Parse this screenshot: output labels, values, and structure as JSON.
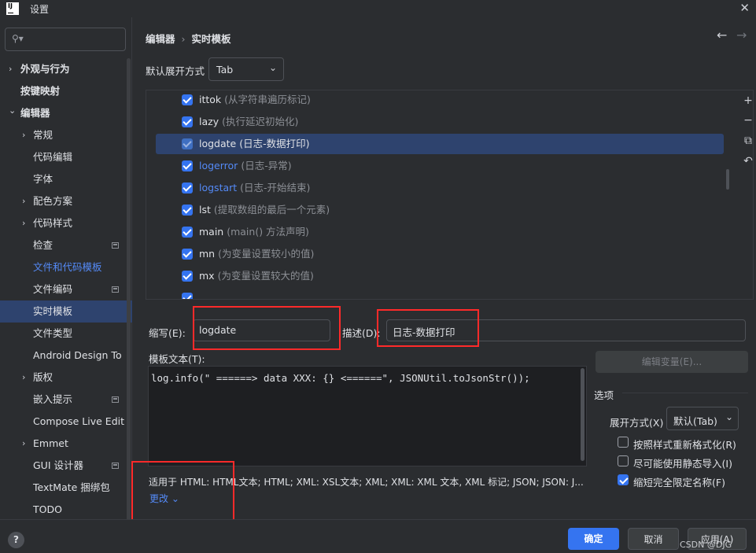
{
  "window": {
    "title": "设置",
    "logo_text": "IJ"
  },
  "sidebar": {
    "search_placeholder": "",
    "items": [
      {
        "label": "外观与行为",
        "chevron": "›"
      },
      {
        "label": "按键映射"
      },
      {
        "label": "编辑器",
        "chevron": "⌄"
      },
      {
        "label": "常规",
        "chevron": "›"
      },
      {
        "label": "代码编辑"
      },
      {
        "label": "字体"
      },
      {
        "label": "配色方案",
        "chevron": "›"
      },
      {
        "label": "代码样式",
        "chevron": "›"
      },
      {
        "label": "检查"
      },
      {
        "label": "文件和代码模板"
      },
      {
        "label": "文件编码"
      },
      {
        "label": "实时模板"
      },
      {
        "label": "文件类型"
      },
      {
        "label": "Android Design To"
      },
      {
        "label": "版权",
        "chevron": "›"
      },
      {
        "label": "嵌入提示"
      },
      {
        "label": "Compose Live Edit"
      },
      {
        "label": "Emmet",
        "chevron": "›"
      },
      {
        "label": "GUI 设计器"
      },
      {
        "label": "TextMate 捆绑包"
      },
      {
        "label": "TODO"
      }
    ]
  },
  "main": {
    "breadcrumb": {
      "parent": "编辑器",
      "separator": "›",
      "current": "实时模板"
    },
    "nav": {
      "back": "←",
      "forward": "→"
    },
    "expand_with": {
      "label": "默认展开方式",
      "value": "Tab",
      "arrow": "⌄"
    },
    "templates": [
      {
        "key": "ittok",
        "desc": "(从字符串遍历标记)"
      },
      {
        "key": "lazy",
        "desc": "(执行延迟初始化)"
      },
      {
        "key": "logdate",
        "desc": "(日志-数据打印)"
      },
      {
        "key": "logerror",
        "desc": "(日志-异常)"
      },
      {
        "key": "logstart",
        "desc": "(日志-开始结束)"
      },
      {
        "key": "lst",
        "desc": "(提取数组的最后一个元素)"
      },
      {
        "key": "main",
        "desc": "(main() 方法声明)"
      },
      {
        "key": "mn",
        "desc": "(为变量设置较小的值)"
      },
      {
        "key": "mx",
        "desc": "(为变量设置较大的值)"
      }
    ],
    "toolbar": {
      "add": "+",
      "remove": "−",
      "copy": "⧉",
      "revert": "↶"
    },
    "abbreviation": {
      "label": "缩写(E):",
      "value": "logdate"
    },
    "description": {
      "label": "描述(D):",
      "value": "日志-数据打印"
    },
    "template_text": {
      "label": "模板文本(T):",
      "code": "log.info(\" ======> data XXX: {} <======\", JSONUtil.toJsonStr());"
    },
    "edit_variables": "编辑变量(E)...",
    "options": {
      "title": "选项",
      "expand_label": "展开方式(X)",
      "expand_value": "默认(Tab)",
      "checks": [
        {
          "label": "按照样式重新格式化(R)",
          "checked": false
        },
        {
          "label": "尽可能使用静态导入(I)",
          "checked": false
        },
        {
          "label": "缩短完全限定名称(F)",
          "checked": true
        }
      ]
    },
    "applies_to": "适用于 HTML: HTML文本; HTML; XML: XSL文本; XML; XML: XML 文本, XML 标记; JSON; JSON: J...",
    "change": "更改 ⌄"
  },
  "footer": {
    "help": "?",
    "ok": "确定",
    "cancel": "取消",
    "apply": "应用(A)",
    "watermark": "CSDN @DJG"
  },
  "colors": {
    "accent": "#3574f0",
    "selection": "#2e436e",
    "link": "#548af7",
    "highlight_box": "#ff2a2a",
    "background": "#2b2d30",
    "editor_bg": "#1e1f22"
  }
}
